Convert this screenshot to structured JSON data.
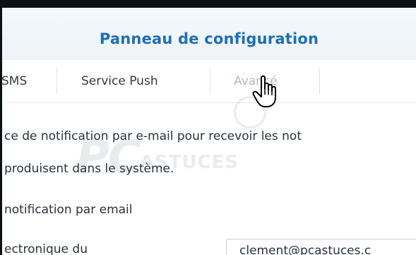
{
  "header": {
    "title": "Panneau de configuration"
  },
  "tabs": [
    {
      "label": "SMS"
    },
    {
      "label": "Service Push"
    },
    {
      "label": "Avancé"
    }
  ],
  "content": {
    "description_line1": "ce de notification par e-mail pour recevoir les not",
    "description_line2": "produisent dans le système.",
    "section_label": "notification par email",
    "field_label": "ectronique du",
    "email_value": "clement@pcastuces.c"
  },
  "watermark": {
    "part1": "PC",
    "part2": "ASTUCES"
  },
  "colors": {
    "title": "#1f6fb3",
    "text": "#2b323b",
    "border_dark": "#0e1017"
  },
  "icons": {
    "cursor": "hand-pointer-icon"
  }
}
